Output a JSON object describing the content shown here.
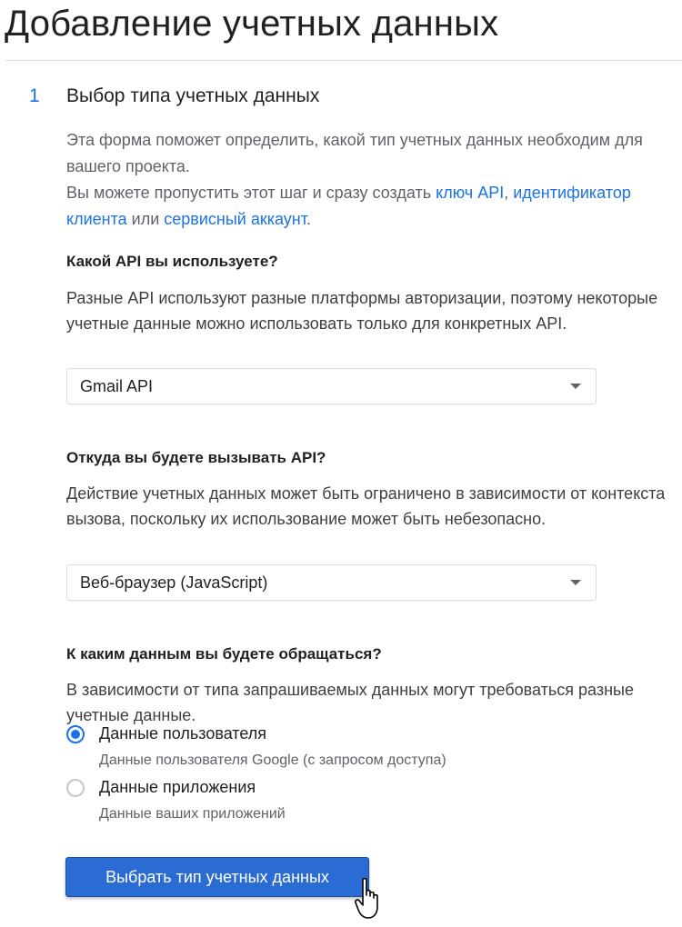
{
  "page": {
    "title": "Добавление учетных данных"
  },
  "step": {
    "number": "1",
    "title": "Выбор типа учетных данных",
    "intro_line1": "Эта форма поможет определить, какой тип учетных данных необходим для вашего проекта.",
    "intro_line2_prefix": "Вы можете пропустить этот шаг и сразу создать ",
    "link_api_key": "ключ API",
    "intro_comma": ",",
    "link_client_id": "идентификатор клиента",
    "intro_or": " или ",
    "link_service_account": "сервисный аккаунт",
    "intro_end": "."
  },
  "q1": {
    "title": "Какой API вы используете?",
    "description": "Разные API используют разные платформы авторизации, поэтому некоторые учетные данные можно использовать только для конкретных API.",
    "selected": "Gmail API"
  },
  "q2": {
    "title": "Откуда вы будете вызывать API?",
    "description": "Действие учетных данных может быть ограничено в зависимости от контекста вызова, поскольку их использование может быть небезопасно.",
    "selected": "Веб-браузер (JavaScript)"
  },
  "q3": {
    "title": "К каким данным вы будете обращаться?",
    "description": "В зависимости от типа запрашиваемых данных могут требоваться разные учетные данные.",
    "options": [
      {
        "label": "Данные пользователя",
        "description": "Данные пользователя Google (с запросом доступа)",
        "checked": true
      },
      {
        "label": "Данные приложения",
        "description": "Данные ваших приложений",
        "checked": false
      }
    ]
  },
  "submit_label": "Выбрать тип учетных данных",
  "colors": {
    "accent": "#1a73e8",
    "button": "#2b6cd4"
  }
}
